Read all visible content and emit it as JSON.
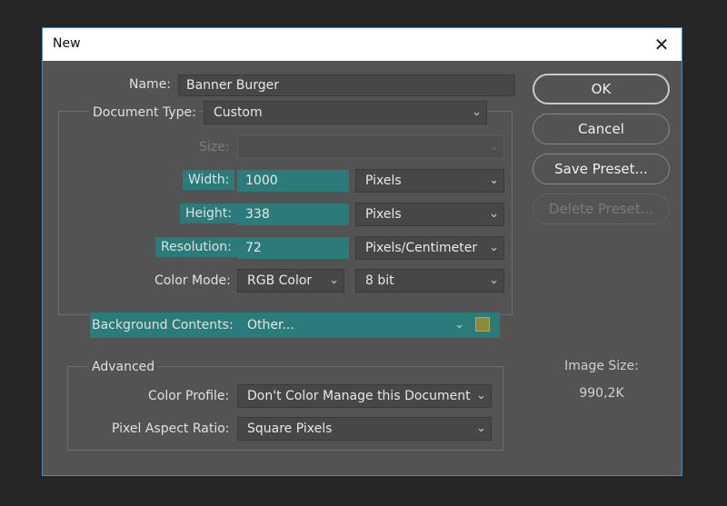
{
  "dialog": {
    "title": "New",
    "close_glyph": "✕"
  },
  "name": {
    "label": "Name:",
    "value": "Banner Burger"
  },
  "document_type": {
    "label": "Document Type:",
    "value": "Custom"
  },
  "size": {
    "label": "Size:",
    "value": ""
  },
  "width": {
    "label": "Width:",
    "value": "1000",
    "unit": "Pixels"
  },
  "height": {
    "label": "Height:",
    "value": "338",
    "unit": "Pixels"
  },
  "resolution": {
    "label": "Resolution:",
    "value": "72",
    "unit": "Pixels/Centimeter"
  },
  "color_mode": {
    "label": "Color Mode:",
    "mode": "RGB Color",
    "depth": "8 bit"
  },
  "background_contents": {
    "label": "Background Contents:",
    "value": "Other...",
    "swatch_color": "#8a8a3a"
  },
  "advanced": {
    "title": "Advanced",
    "color_profile": {
      "label": "Color Profile:",
      "value": "Don't Color Manage this Document"
    },
    "pixel_aspect": {
      "label": "Pixel Aspect Ratio:",
      "value": "Square Pixels"
    }
  },
  "buttons": {
    "ok": "OK",
    "cancel": "Cancel",
    "save_preset": "Save Preset...",
    "delete_preset": "Delete Preset..."
  },
  "image_size": {
    "label": "Image Size:",
    "value": "990,2K"
  },
  "colors": {
    "highlight": "#2b7b7b",
    "dialog_bg": "#535353",
    "border_accent": "#5a86a7"
  }
}
